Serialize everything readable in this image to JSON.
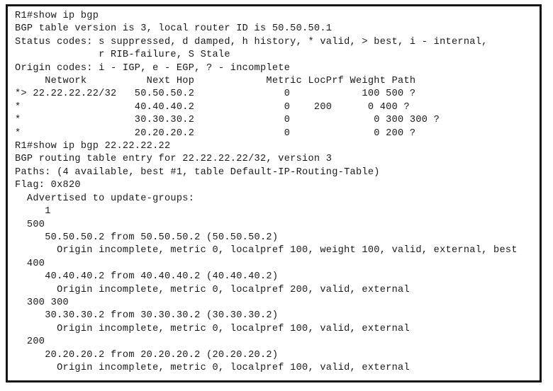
{
  "terminal": {
    "prompt": "R1#",
    "device_name": "R1",
    "commands": [
      "show ip bgp",
      "show ip bgp 22.22.22.22"
    ],
    "summary": {
      "table_version_line": "BGP table version is 3, local router ID is 50.50.50.1",
      "table_version": "3",
      "local_router_id": "50.50.50.1",
      "status_codes_line_1": "Status codes: s suppressed, d damped, h history, * valid, > best, i - internal,",
      "status_codes_line_2": "              r RIB-failure, S Stale",
      "origin_codes_line": "Origin codes: i - IGP, e - EGP, ? - incomplete"
    },
    "bgp_table": {
      "headers": [
        "Network",
        "Next Hop",
        "Metric",
        "LocPrf",
        "Weight",
        "Path"
      ],
      "header_line": "     Network          Next Hop            Metric LocPrf Weight Path",
      "rows": [
        {
          "status": "*>",
          "network": "22.22.22.22/32",
          "next_hop": "50.50.50.2",
          "metric": "0",
          "locprf": "",
          "weight": "100",
          "path": "500 ?",
          "line": "*> 22.22.22.22/32   50.50.50.2               0            100 500 ?"
        },
        {
          "status": "*",
          "network": "",
          "next_hop": "40.40.40.2",
          "metric": "0",
          "locprf": "200",
          "weight": "0",
          "path": "400 ?",
          "line": "*                   40.40.40.2               0    200      0 400 ?"
        },
        {
          "status": "*",
          "network": "",
          "next_hop": "30.30.30.2",
          "metric": "0",
          "locprf": "",
          "weight": "0",
          "path": "300 300 ?",
          "line": "*                   30.30.30.2               0              0 300 300 ?"
        },
        {
          "status": "*",
          "network": "",
          "next_hop": "20.20.20.2",
          "metric": "0",
          "locprf": "",
          "weight": "0",
          "path": "200 ?",
          "line": "*                   20.20.20.2               0              0 200 ?"
        }
      ]
    },
    "route_detail": {
      "entry_line": "BGP routing table entry for 22.22.22.22/32, version 3",
      "prefix": "22.22.22.22/32",
      "version": "3",
      "paths_line": "Paths: (4 available, best #1, table Default-IP-Routing-Table)",
      "paths_available": "4",
      "best_path": "#1",
      "table_name": "Default-IP-Routing-Table",
      "flag_line": "Flag: 0x820",
      "flag": "0x820",
      "advertised_label": "  Advertised to update-groups:",
      "advertised_groups": "     1",
      "paths": [
        {
          "as_path": "  500",
          "peer_line": "     50.50.50.2 from 50.50.50.2 (50.50.50.2)",
          "attributes_line": "       Origin incomplete, metric 0, localpref 100, weight 100, valid, external, best"
        },
        {
          "as_path": "  400",
          "peer_line": "     40.40.40.2 from 40.40.40.2 (40.40.40.2)",
          "attributes_line": "       Origin incomplete, metric 0, localpref 200, valid, external"
        },
        {
          "as_path": "  300 300",
          "peer_line": "     30.30.30.2 from 30.30.30.2 (30.30.30.2)",
          "attributes_line": "       Origin incomplete, metric 0, localpref 100, valid, external"
        },
        {
          "as_path": "  200",
          "peer_line": "     20.20.20.2 from 20.20.20.2 (20.20.20.2)",
          "attributes_line": "       Origin incomplete, metric 0, localpref 100, valid, external"
        }
      ]
    },
    "lines": [
      "R1#show ip bgp",
      "BGP table version is 3, local router ID is 50.50.50.1",
      "Status codes: s suppressed, d damped, h history, * valid, > best, i - internal,",
      "              r RIB-failure, S Stale",
      "Origin codes: i - IGP, e - EGP, ? - incomplete",
      "",
      "     Network          Next Hop            Metric LocPrf Weight Path",
      "*> 22.22.22.22/32   50.50.50.2               0            100 500 ?",
      "*                   40.40.40.2               0    200      0 400 ?",
      "*                   30.30.30.2               0              0 300 300 ?",
      "*                   20.20.20.2               0              0 200 ?",
      "R1#show ip bgp 22.22.22.22",
      "BGP routing table entry for 22.22.22.22/32, version 3",
      "Paths: (4 available, best #1, table Default-IP-Routing-Table)",
      "Flag: 0x820",
      "  Advertised to update-groups:",
      "     1",
      "  500",
      "     50.50.50.2 from 50.50.50.2 (50.50.50.2)",
      "       Origin incomplete, metric 0, localpref 100, weight 100, valid, external, best",
      "  400",
      "     40.40.40.2 from 40.40.40.2 (40.40.40.2)",
      "       Origin incomplete, metric 0, localpref 200, valid, external",
      "  300 300",
      "     30.30.30.2 from 30.30.30.2 (30.30.30.2)",
      "       Origin incomplete, metric 0, localpref 100, valid, external",
      "  200",
      "     20.20.20.2 from 20.20.20.2 (20.20.20.2)",
      "       Origin incomplete, metric 0, localpref 100, valid, external"
    ]
  },
  "colors": {
    "background": "#ffffff",
    "text": "#1a1a1a",
    "border": "#151515"
  }
}
